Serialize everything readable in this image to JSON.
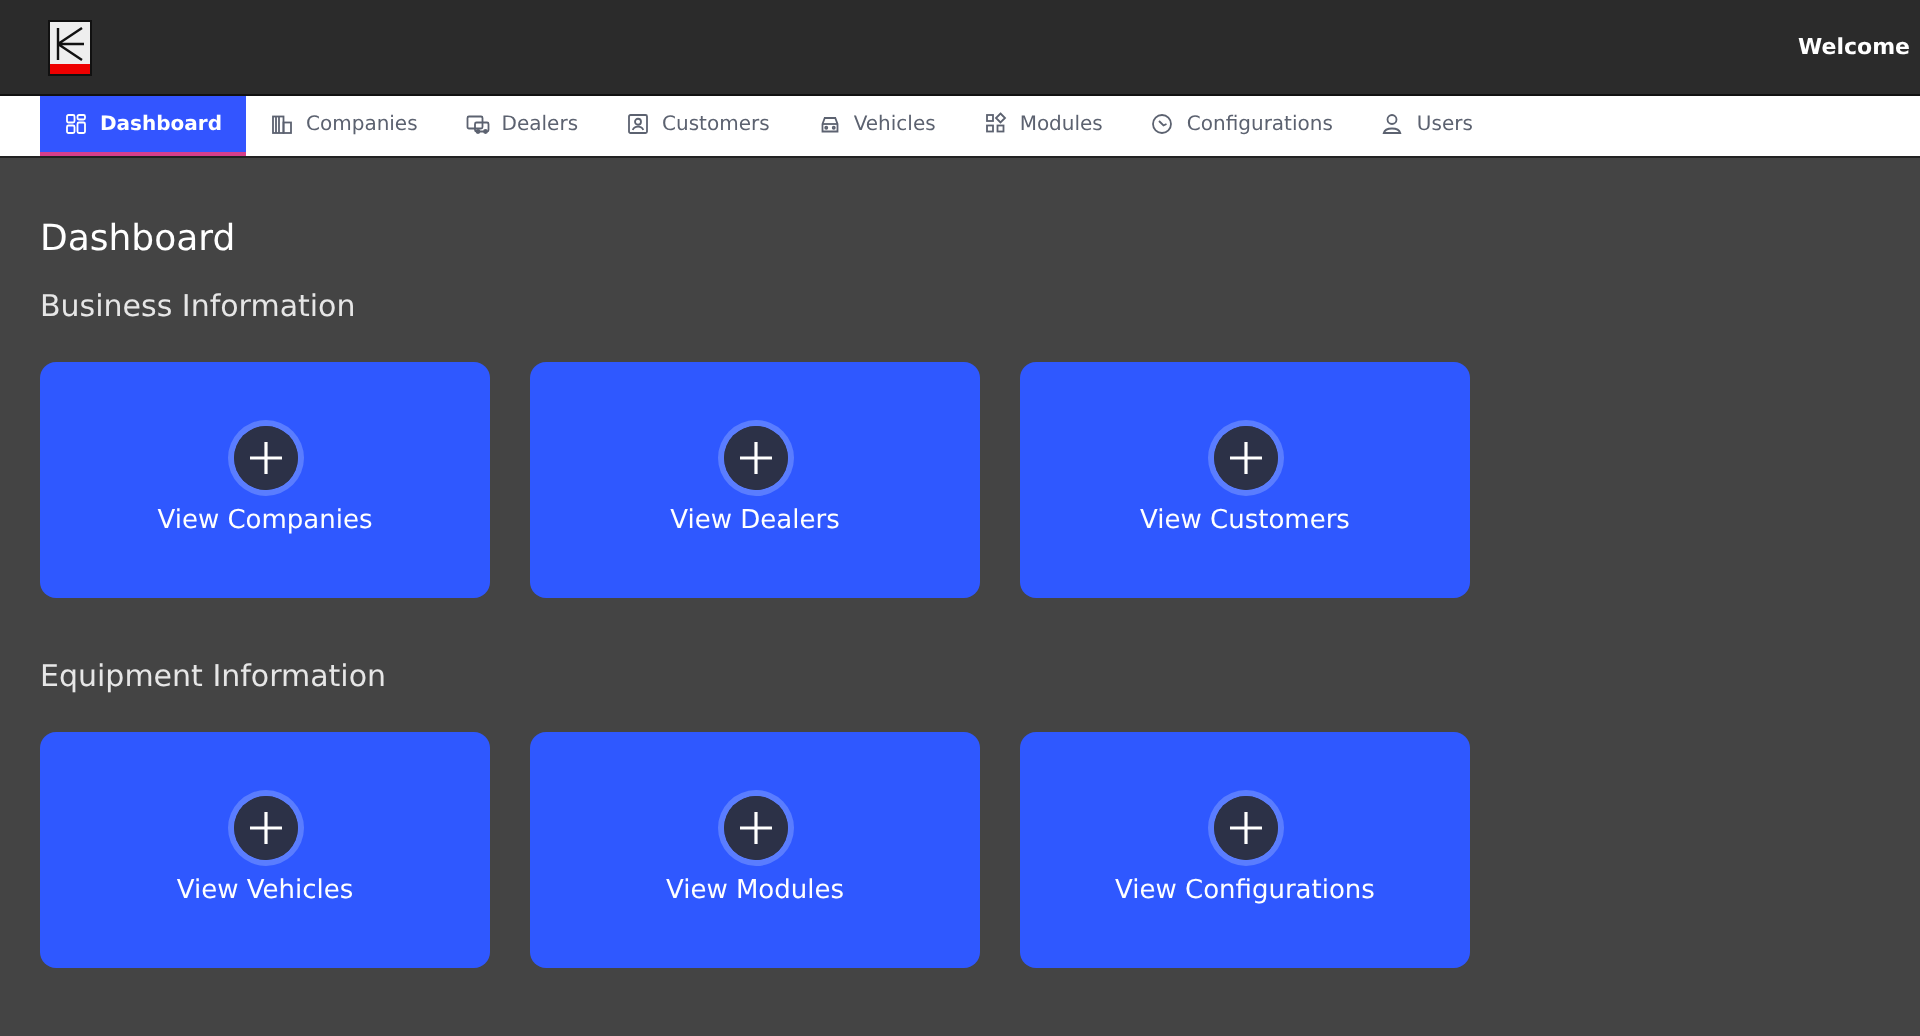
{
  "header": {
    "welcome": "Welcome"
  },
  "tabs": [
    {
      "label": "Dashboard",
      "selected": true
    },
    {
      "label": "Companies",
      "selected": false
    },
    {
      "label": "Dealers",
      "selected": false
    },
    {
      "label": "Customers",
      "selected": false
    },
    {
      "label": "Vehicles",
      "selected": false
    },
    {
      "label": "Modules",
      "selected": false
    },
    {
      "label": "Configurations",
      "selected": false
    },
    {
      "label": "Users",
      "selected": false
    }
  ],
  "page_title": "Dashboard",
  "sections": [
    {
      "title": "Business Information",
      "cards": [
        {
          "label": "View Companies"
        },
        {
          "label": "View Dealers"
        },
        {
          "label": "View Customers"
        }
      ]
    },
    {
      "title": "Equipment Information",
      "cards": [
        {
          "label": "View Vehicles"
        },
        {
          "label": "View Modules"
        },
        {
          "label": "View Configurations"
        }
      ]
    }
  ]
}
